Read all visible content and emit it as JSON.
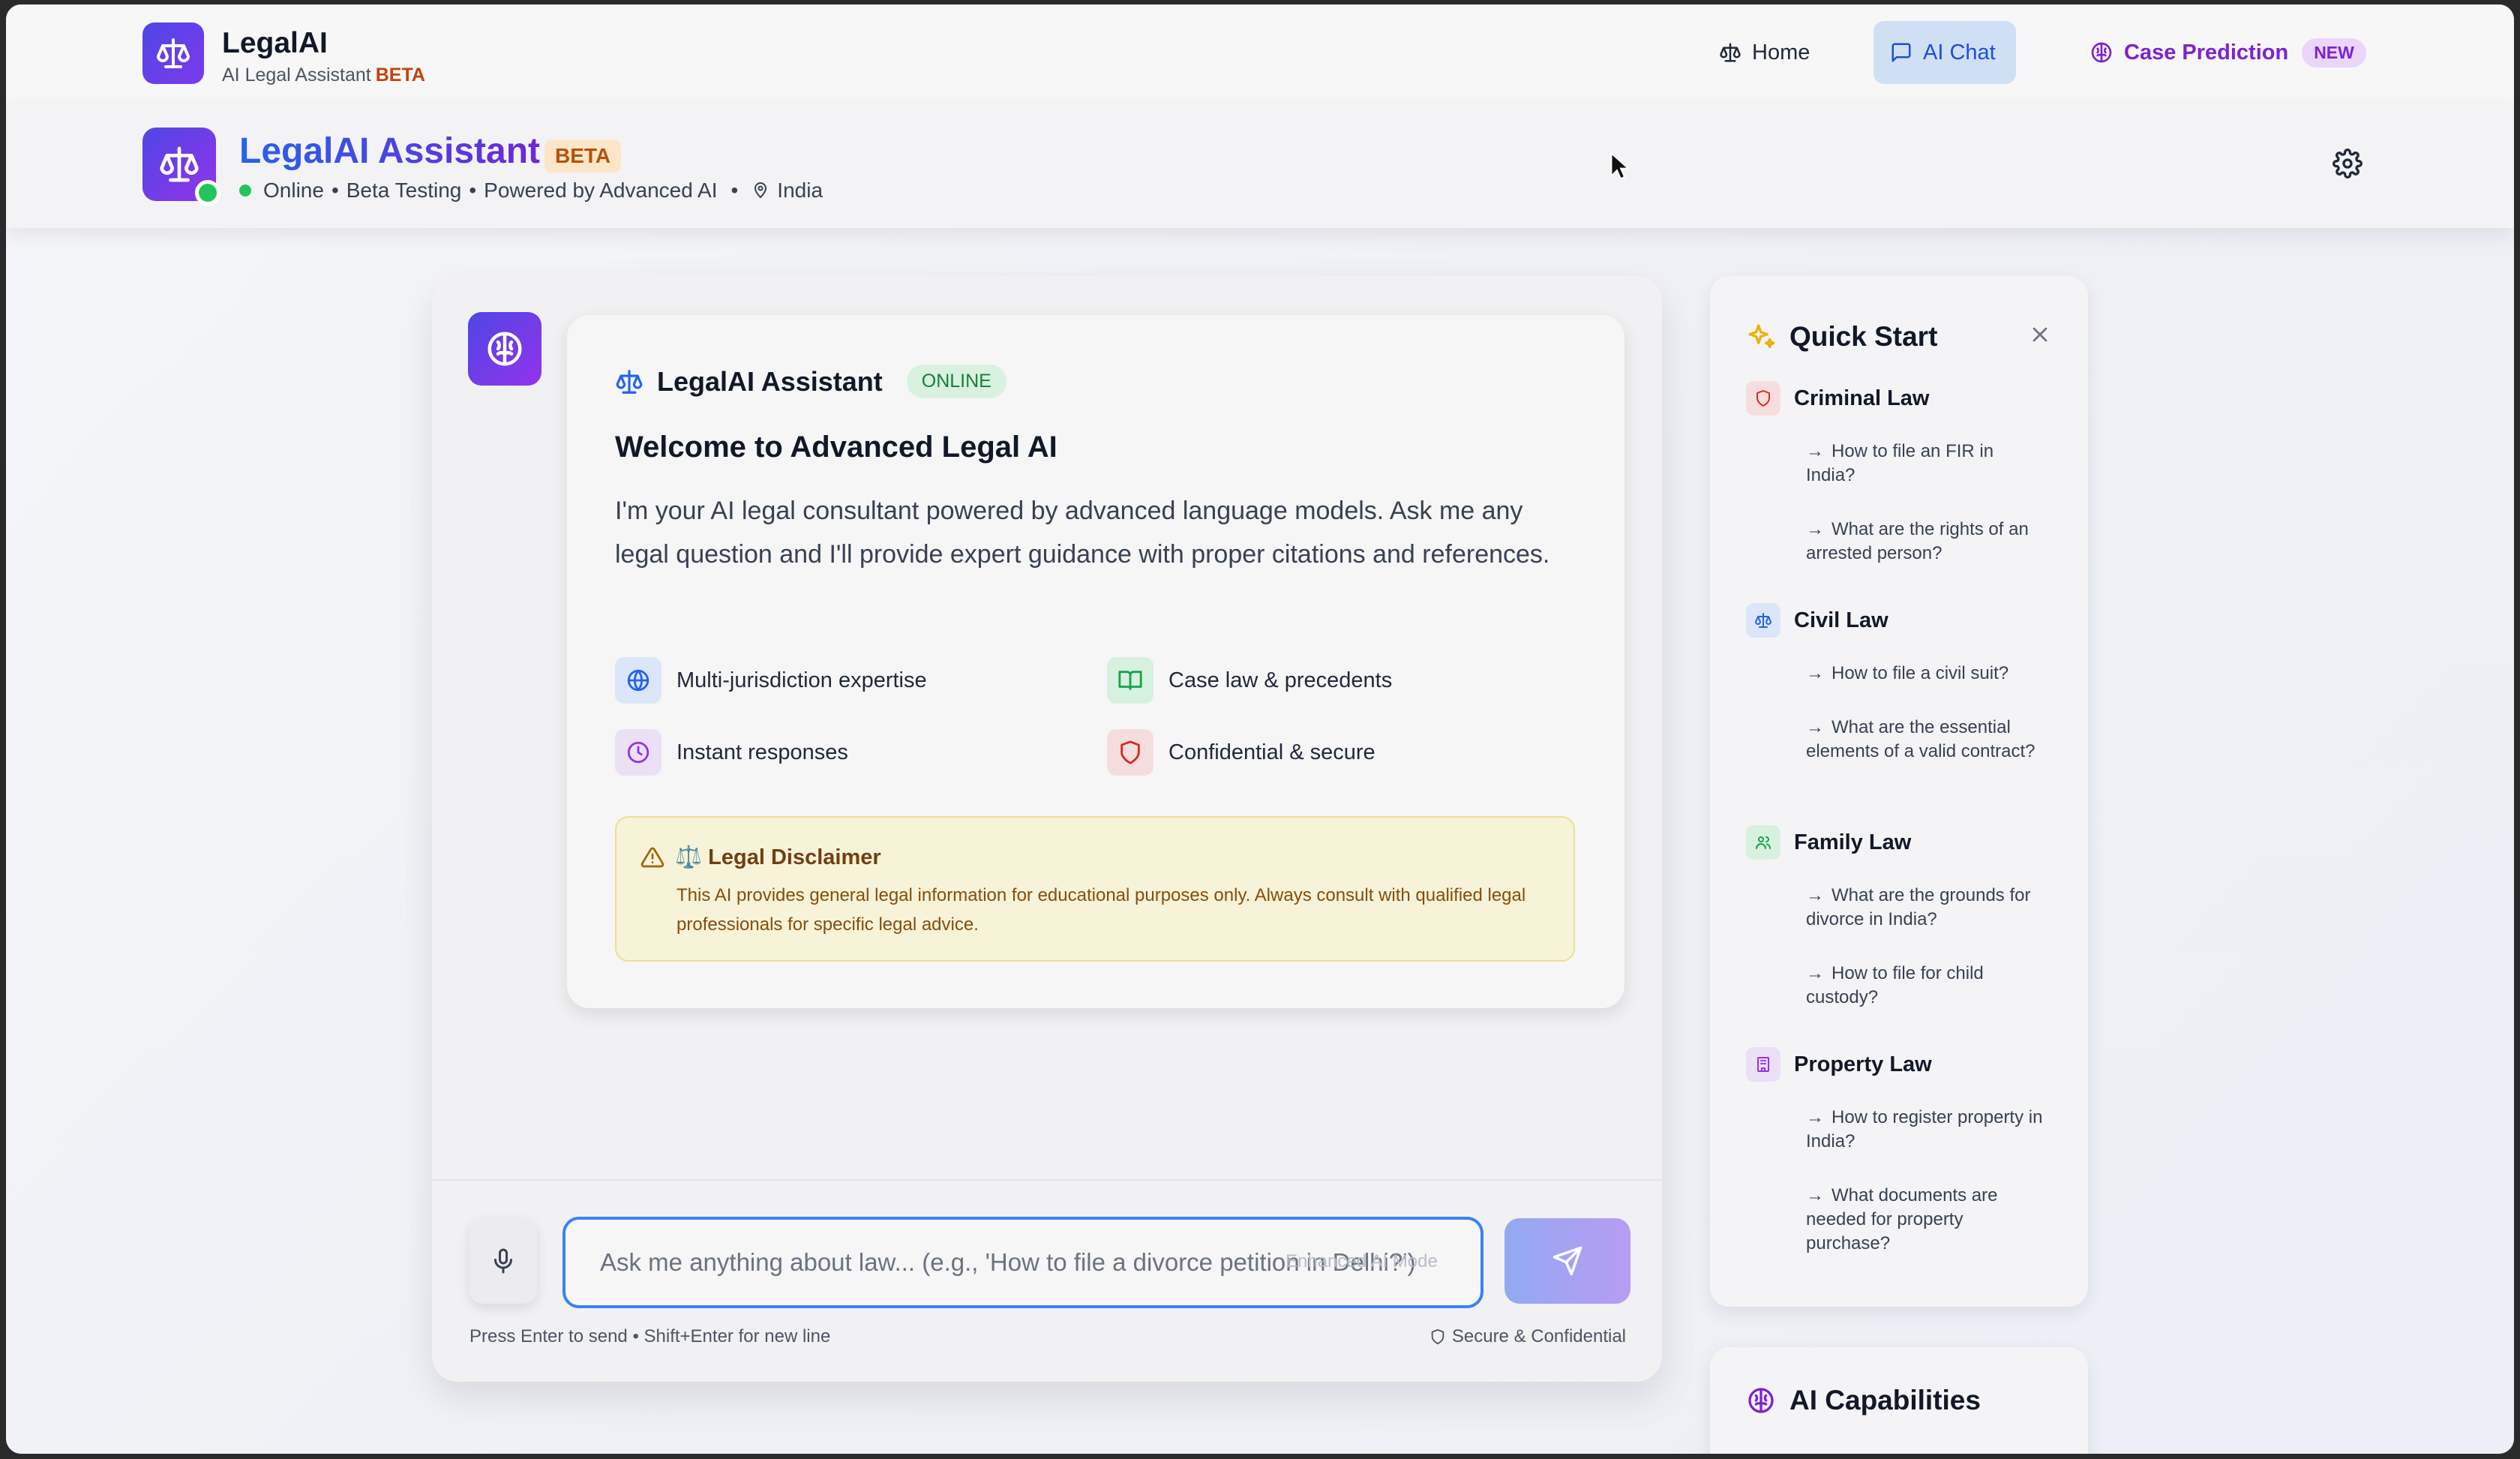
{
  "topnav": {
    "brand_name": "LegalAI",
    "brand_sub": "AI Legal Assistant",
    "brand_badge": "BETA",
    "nav": {
      "home": "Home",
      "chat": "AI Chat",
      "prediction": "Case Prediction",
      "prediction_badge": "NEW"
    }
  },
  "assistant_header": {
    "title": "LegalAI Assistant",
    "badge": "BETA",
    "status": "Online",
    "status_detail": "Beta Testing",
    "powered": "Powered by Advanced AI",
    "region": "India"
  },
  "welcome": {
    "name": "LegalAI Assistant",
    "online_badge": "ONLINE",
    "title": "Welcome to Advanced Legal AI",
    "body": "I'm your AI legal consultant powered by advanced language models. Ask me any legal question and I'll provide expert guidance with proper citations and references.",
    "features": [
      "Multi-jurisdiction expertise",
      "Case law & precedents",
      "Instant responses",
      "Confidential & secure"
    ],
    "disclaimer_title": "⚖️ Legal Disclaimer",
    "disclaimer_text": "This AI provides general legal information for educational purposes only. Always consult with qualified legal professionals for specific legal advice."
  },
  "composer": {
    "placeholder": "Ask me anything about law... (e.g., 'How to file a divorce petition in Delhi?')",
    "mode_hint": "Enhanced AI Mode",
    "hint_left": "Press Enter to send • Shift+Enter for new line",
    "hint_right": "Secure & Confidential"
  },
  "quick_start": {
    "title": "Quick Start",
    "categories": [
      {
        "name": "Criminal Law",
        "items": [
          "How to file an FIR in India?",
          "What are the rights of an arrested person?"
        ]
      },
      {
        "name": "Civil Law",
        "items": [
          "How to file a civil suit?",
          "What are the essential elements of a valid contract?"
        ]
      },
      {
        "name": "Family Law",
        "items": [
          "What are the grounds for divorce in India?",
          "How to file for child custody?"
        ]
      },
      {
        "name": "Property Law",
        "items": [
          "How to register property in India?",
          "What documents are needed for property purchase?"
        ]
      }
    ]
  },
  "capabilities": {
    "title": "AI Capabilities"
  },
  "colors": {
    "accent": "#4f46e5",
    "purple": "#7e22ce",
    "online": "#22c55e",
    "input_border": "#3b82f6"
  },
  "icons": [
    "scales-icon",
    "chat-icon",
    "brain-icon",
    "settings-icon",
    "globe-icon",
    "book-icon",
    "clock-icon",
    "shield-icon",
    "warning-icon",
    "mic-icon",
    "send-icon",
    "sparkles-icon",
    "close-icon",
    "users-icon",
    "building-icon",
    "map-pin-icon"
  ]
}
